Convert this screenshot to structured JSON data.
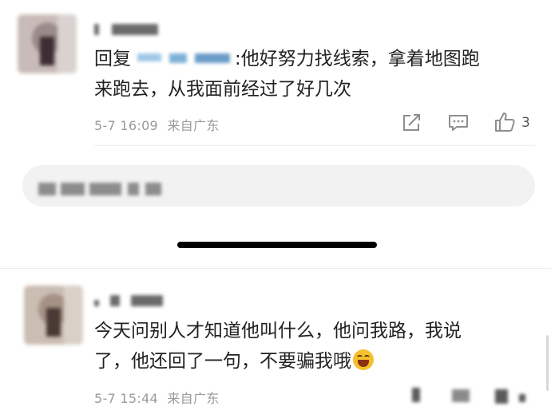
{
  "comment1": {
    "reply_prefix": "回复",
    "text_line1": ":他好努力找线索，拿着地图跑",
    "text_line2": "来跑去，从我面前经过了好几次",
    "date": "5-7 16:09",
    "location": "来自广东",
    "like_count": "3"
  },
  "comment2": {
    "text_line1": "今天问别人才知道他叫什么，他问我路，我说",
    "text_line2": "了，他还回了一句，不要骗我哦",
    "date": "5-7 15:44",
    "location": "来自广东"
  },
  "icons": {
    "share": "share-icon",
    "comment": "comment-icon",
    "like": "thumbs-up-icon",
    "emoji": "laughing-emoji-icon"
  },
  "colors": {
    "text": "#222222",
    "meta": "#9a9a9a",
    "reply_box": "#f2f2f2"
  }
}
